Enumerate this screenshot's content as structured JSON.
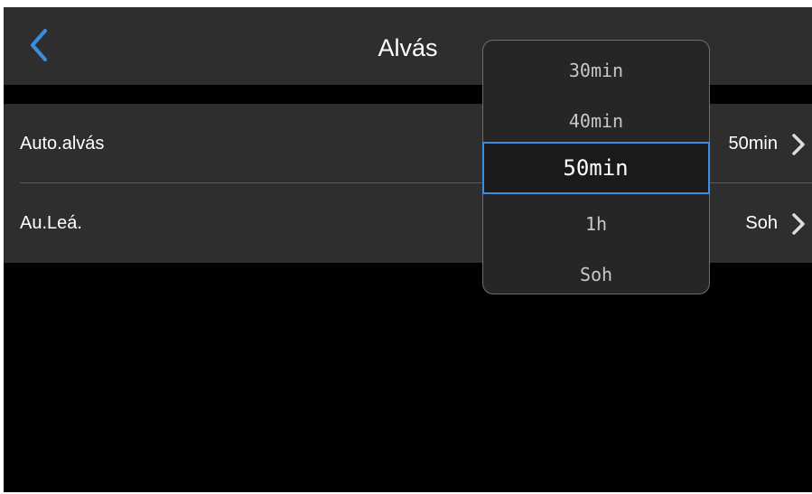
{
  "header": {
    "title": "Alvás",
    "back_icon": "chevron-left-icon"
  },
  "settings": [
    {
      "label": "Auto.alvás",
      "value": "50min"
    },
    {
      "label": "Au.Leá.",
      "value": "Soh"
    }
  ],
  "picker": {
    "options": [
      "30min",
      "40min",
      "50min",
      "1h",
      "Soh"
    ],
    "selected": "50min"
  },
  "colors": {
    "accent": "#3a8de0",
    "panel": "#2e2e2e",
    "background": "#000000"
  }
}
